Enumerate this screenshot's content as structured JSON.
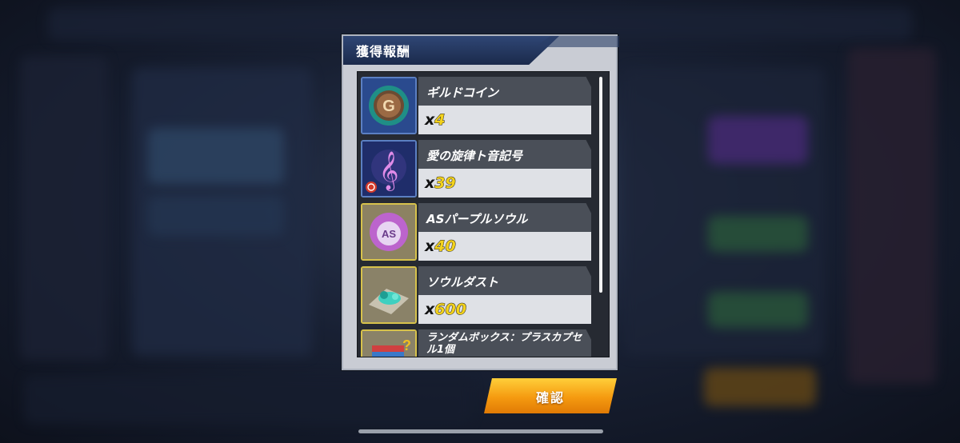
{
  "dialog": {
    "title": "獲得報酬",
    "items": [
      {
        "name": "ギルドコイン",
        "qty_prefix": "x",
        "qty": "4",
        "icon": "guild-coin-icon"
      },
      {
        "name": "愛の旋律ト音記号",
        "qty_prefix": "x",
        "qty": "39",
        "icon": "treble-clef-icon"
      },
      {
        "name": "ASパープルソウル",
        "qty_prefix": "x",
        "qty": "40",
        "icon": "purple-soul-icon"
      },
      {
        "name": "ソウルダスト",
        "qty_prefix": "x",
        "qty": "600",
        "icon": "soul-dust-icon"
      },
      {
        "name": "ランダムボックス：プラスカプセル1個",
        "icon": "random-box-icon"
      }
    ],
    "confirm_label": "確認"
  },
  "colors": {
    "confirm_button": "#f59a10",
    "quantity": "#f3d21c",
    "header_band": "#1b2a4b"
  }
}
